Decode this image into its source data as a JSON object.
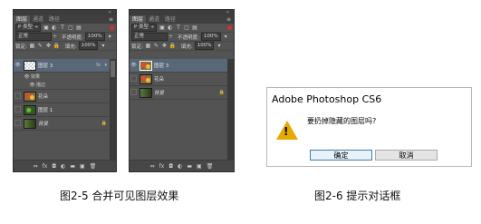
{
  "panel_tabs": [
    "图层",
    "通道",
    "路径"
  ],
  "filter": {
    "kind": "P 类型 ÷"
  },
  "blend": {
    "mode": "正常",
    "opacity_label": "不透明度:",
    "opacity_value": "100%"
  },
  "lock": {
    "label": "锁定:",
    "fill_label": "填充:",
    "fill_value": "100%"
  },
  "panel_a": {
    "layers": [
      {
        "name": "图层 3",
        "fx": "fx"
      },
      {
        "name": "效果"
      },
      {
        "name": "描边"
      },
      {
        "name": "花朵"
      },
      {
        "name": "图层 1"
      },
      {
        "name": "背景"
      }
    ]
  },
  "panel_b": {
    "layers": [
      {
        "name": "图层 3"
      },
      {
        "name": "花朵"
      },
      {
        "name": "背景"
      }
    ]
  },
  "bottom_bar": [
    "⇔",
    "fx",
    "◘",
    "◐",
    "▬",
    "▣",
    "🗑"
  ],
  "captions": {
    "fig5": "图2-5 合并可见图层效果",
    "fig6": "图2-6 提示对话框"
  },
  "dialog": {
    "title": "Adobe Photoshop CS6",
    "message": "要扔掉隐藏的图层吗?",
    "ok": "确定",
    "cancel": "取消"
  },
  "colors": {
    "panel": "#535353",
    "selected_layer": "#596878",
    "warning": "#e5a900"
  }
}
